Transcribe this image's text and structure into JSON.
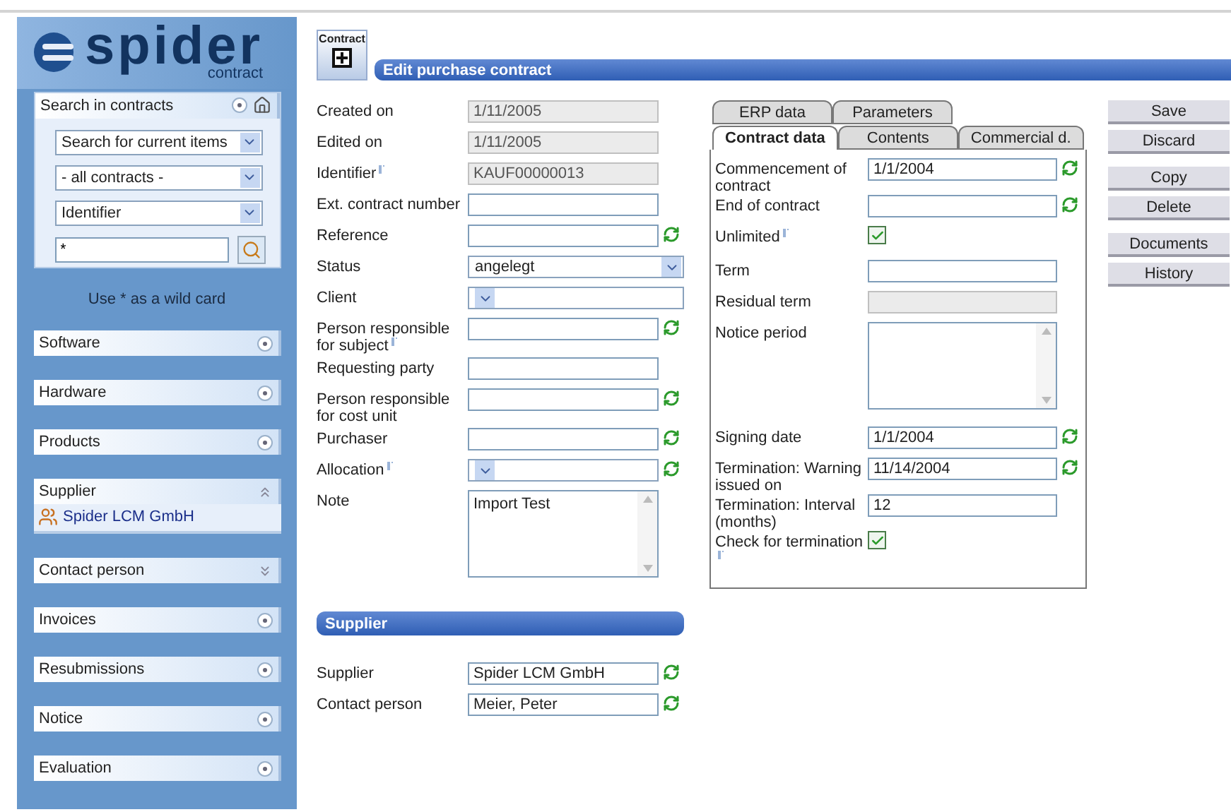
{
  "logo": {
    "name": "spider",
    "sub": "contract"
  },
  "search_panel": {
    "title": "Search in contracts",
    "selects": [
      "Search for current items",
      "- all contracts -",
      "Identifier"
    ],
    "query": "*",
    "hint": "Use * as a wild card"
  },
  "sidebar_panels": [
    {
      "title": "Software",
      "kind": "empty"
    },
    {
      "title": "Hardware",
      "kind": "empty"
    },
    {
      "title": "Products",
      "kind": "empty"
    },
    {
      "title": "Supplier",
      "kind": "content",
      "expanded": true,
      "items": [
        {
          "label": "Spider LCM GmbH"
        }
      ]
    },
    {
      "title": "Contact person",
      "kind": "content",
      "expanded": false
    },
    {
      "title": "Invoices",
      "kind": "empty"
    },
    {
      "title": "Resubmissions",
      "kind": "empty"
    },
    {
      "title": "Notice",
      "kind": "empty"
    },
    {
      "title": "Evaluation",
      "kind": "empty"
    }
  ],
  "header": {
    "icon_label": "Contract",
    "title": "Edit purchase contract"
  },
  "form": [
    {
      "label": "Created on",
      "kind": "readonly",
      "value": "1/11/2005",
      "info": false,
      "refresh": false
    },
    {
      "label": "Edited on",
      "kind": "readonly",
      "value": "1/11/2005",
      "info": false,
      "refresh": false
    },
    {
      "label": "Identifier",
      "kind": "readonly",
      "value": "KAUF00000013",
      "info": true,
      "refresh": false
    },
    {
      "label": "Ext. contract number",
      "kind": "text",
      "info": false,
      "refresh": false
    },
    {
      "label": "Reference",
      "kind": "text",
      "info": false,
      "refresh": true
    },
    {
      "label": "Status",
      "kind": "select",
      "value": "angelegt",
      "info": false,
      "refresh": false
    },
    {
      "label": "Client",
      "kind": "select",
      "info": false,
      "refresh": false
    },
    {
      "label": "Person responsible for subject",
      "kind": "text",
      "info": true,
      "refresh": true
    },
    {
      "label": "Requesting party",
      "kind": "text",
      "info": false,
      "refresh": false
    },
    {
      "label": "Person responsible for cost unit",
      "kind": "text",
      "info": false,
      "refresh": true
    },
    {
      "label": "Purchaser",
      "kind": "text",
      "info": false,
      "refresh": true
    },
    {
      "label": "Allocation",
      "kind": "select",
      "info": true,
      "refresh": true
    },
    {
      "label": "Note",
      "kind": "textarea",
      "value": "Import Test",
      "info": false,
      "refresh": false
    }
  ],
  "supplier_section": {
    "title": "Supplier",
    "fields": [
      {
        "label": "Supplier",
        "kind": "text",
        "value": "Spider LCM GmbH",
        "info": false,
        "refresh": true
      },
      {
        "label": "Contact person",
        "kind": "text",
        "value": "Meier, Peter",
        "info": false,
        "refresh": true
      }
    ]
  },
  "tab_rows": [
    {
      "tabs": [
        {
          "label": "ERP data",
          "selected": false
        },
        {
          "label": "Parameters",
          "selected": false
        }
      ]
    },
    {
      "tabs": [
        {
          "label": "Contract data",
          "selected": true
        },
        {
          "label": "Contents",
          "selected": false
        },
        {
          "label": "Commercial d.",
          "selected": false
        }
      ]
    }
  ],
  "contract_data": [
    {
      "label": "Commencement of contract",
      "kind": "text",
      "value": "1/1/2004",
      "info": false,
      "refresh": true
    },
    {
      "label": "End of contract",
      "kind": "text",
      "info": false,
      "refresh": true
    },
    {
      "label": "Unlimited",
      "kind": "checkbox",
      "checked": true,
      "info": true,
      "refresh": false
    },
    {
      "label": "Term",
      "kind": "text",
      "info": false,
      "refresh": false
    },
    {
      "label": "Residual term",
      "kind": "readonly",
      "info": false,
      "refresh": false
    },
    {
      "label": "Notice period",
      "kind": "textarea",
      "info": false,
      "refresh": false
    },
    {
      "label": "Signing date",
      "kind": "text",
      "value": "1/1/2004",
      "info": false,
      "refresh": true
    },
    {
      "label": "Termination: Warning issued on",
      "kind": "text",
      "value": "11/14/2004",
      "info": false,
      "refresh": true
    },
    {
      "label": "Termination: Interval (months)",
      "kind": "text",
      "value": "12",
      "info": false,
      "refresh": false
    },
    {
      "label": "Check for termination",
      "kind": "checkbox",
      "checked": true,
      "info": true,
      "refresh": false
    }
  ],
  "button_groups": [
    {
      "buttons": [
        "Save",
        "Discard"
      ]
    },
    {
      "buttons": [
        "Copy",
        "Delete"
      ]
    },
    {
      "buttons": [
        "Documents",
        "History"
      ]
    }
  ]
}
